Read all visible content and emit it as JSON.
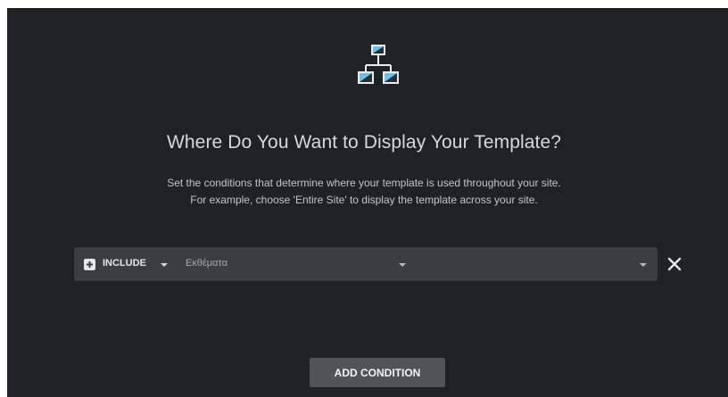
{
  "heading": {
    "title": "Where Do You Want to Display Your Template?",
    "description_line1": "Set the conditions that determine where your template is used throughout your site.",
    "description_line2": "For example, choose 'Entire Site' to display the template across your site."
  },
  "condition": {
    "type_label": "INCLUDE",
    "selected_value": "Εκθέματα"
  },
  "actions": {
    "add_condition_label": "ADD CONDITION"
  },
  "icons": {
    "hero": "sitemap-template-icon",
    "type": "plus-square-icon",
    "remove": "close-icon"
  },
  "colors": {
    "background": "#202124",
    "row": "#3a3d42",
    "button": "#50545a",
    "title": "#d5d8dc",
    "icon_accent": "#6ec1e4"
  }
}
